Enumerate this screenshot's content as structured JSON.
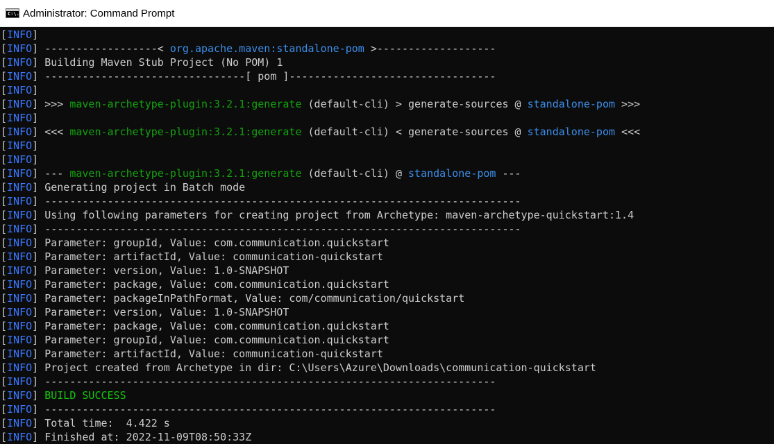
{
  "window": {
    "title": "Administrator: Command Prompt",
    "icon": "cmd-icon",
    "icon_text": "C:\\."
  },
  "colors": {
    "background": "#0c0c0c",
    "default_text": "#cccccc",
    "info_tag": "#3b78ff",
    "plugin_green": "#13a10e",
    "success_green": "#16c60c",
    "project_blue": "#3b8eea"
  },
  "console": {
    "lines": [
      [
        {
          "t": "[",
          "c": "white"
        },
        {
          "t": "INFO",
          "c": "info"
        },
        {
          "t": "]",
          "c": "white"
        }
      ],
      [
        {
          "t": "[",
          "c": "white"
        },
        {
          "t": "INFO",
          "c": "info"
        },
        {
          "t": "] ------------------< ",
          "c": "white"
        },
        {
          "t": "org.apache.maven:standalone-pom",
          "c": "blue"
        },
        {
          "t": " >-------------------",
          "c": "white"
        }
      ],
      [
        {
          "t": "[",
          "c": "white"
        },
        {
          "t": "INFO",
          "c": "info"
        },
        {
          "t": "] Building Maven Stub Project (No POM) 1",
          "c": "white"
        }
      ],
      [
        {
          "t": "[",
          "c": "white"
        },
        {
          "t": "INFO",
          "c": "info"
        },
        {
          "t": "] --------------------------------[ pom ]---------------------------------",
          "c": "white"
        }
      ],
      [
        {
          "t": "[",
          "c": "white"
        },
        {
          "t": "INFO",
          "c": "info"
        },
        {
          "t": "]",
          "c": "white"
        }
      ],
      [
        {
          "t": "[",
          "c": "white"
        },
        {
          "t": "INFO",
          "c": "info"
        },
        {
          "t": "] >>> ",
          "c": "white"
        },
        {
          "t": "maven-archetype-plugin:3.2.1:generate",
          "c": "green"
        },
        {
          "t": " (default-cli) > generate-sources @ ",
          "c": "white"
        },
        {
          "t": "standalone-pom",
          "c": "blue"
        },
        {
          "t": " >>>",
          "c": "white"
        }
      ],
      [
        {
          "t": "[",
          "c": "white"
        },
        {
          "t": "INFO",
          "c": "info"
        },
        {
          "t": "]",
          "c": "white"
        }
      ],
      [
        {
          "t": "[",
          "c": "white"
        },
        {
          "t": "INFO",
          "c": "info"
        },
        {
          "t": "] <<< ",
          "c": "white"
        },
        {
          "t": "maven-archetype-plugin:3.2.1:generate",
          "c": "green"
        },
        {
          "t": " (default-cli) < generate-sources @ ",
          "c": "white"
        },
        {
          "t": "standalone-pom",
          "c": "blue"
        },
        {
          "t": " <<<",
          "c": "white"
        }
      ],
      [
        {
          "t": "[",
          "c": "white"
        },
        {
          "t": "INFO",
          "c": "info"
        },
        {
          "t": "]",
          "c": "white"
        }
      ],
      [
        {
          "t": "[",
          "c": "white"
        },
        {
          "t": "INFO",
          "c": "info"
        },
        {
          "t": "]",
          "c": "white"
        }
      ],
      [
        {
          "t": "[",
          "c": "white"
        },
        {
          "t": "INFO",
          "c": "info"
        },
        {
          "t": "] --- ",
          "c": "white"
        },
        {
          "t": "maven-archetype-plugin:3.2.1:generate",
          "c": "green"
        },
        {
          "t": " (default-cli) @ ",
          "c": "white"
        },
        {
          "t": "standalone-pom",
          "c": "blue"
        },
        {
          "t": " ---",
          "c": "white"
        }
      ],
      [
        {
          "t": "[",
          "c": "white"
        },
        {
          "t": "INFO",
          "c": "info"
        },
        {
          "t": "] Generating project in Batch mode",
          "c": "white"
        }
      ],
      [
        {
          "t": "[",
          "c": "white"
        },
        {
          "t": "INFO",
          "c": "info"
        },
        {
          "t": "] ----------------------------------------------------------------------------",
          "c": "white"
        }
      ],
      [
        {
          "t": "[",
          "c": "white"
        },
        {
          "t": "INFO",
          "c": "info"
        },
        {
          "t": "] Using following parameters for creating project from Archetype: maven-archetype-quickstart:1.4",
          "c": "white"
        }
      ],
      [
        {
          "t": "[",
          "c": "white"
        },
        {
          "t": "INFO",
          "c": "info"
        },
        {
          "t": "] ----------------------------------------------------------------------------",
          "c": "white"
        }
      ],
      [
        {
          "t": "[",
          "c": "white"
        },
        {
          "t": "INFO",
          "c": "info"
        },
        {
          "t": "] Parameter: groupId, Value: com.communication.quickstart",
          "c": "white"
        }
      ],
      [
        {
          "t": "[",
          "c": "white"
        },
        {
          "t": "INFO",
          "c": "info"
        },
        {
          "t": "] Parameter: artifactId, Value: communication-quickstart",
          "c": "white"
        }
      ],
      [
        {
          "t": "[",
          "c": "white"
        },
        {
          "t": "INFO",
          "c": "info"
        },
        {
          "t": "] Parameter: version, Value: 1.0-SNAPSHOT",
          "c": "white"
        }
      ],
      [
        {
          "t": "[",
          "c": "white"
        },
        {
          "t": "INFO",
          "c": "info"
        },
        {
          "t": "] Parameter: package, Value: com.communication.quickstart",
          "c": "white"
        }
      ],
      [
        {
          "t": "[",
          "c": "white"
        },
        {
          "t": "INFO",
          "c": "info"
        },
        {
          "t": "] Parameter: packageInPathFormat, Value: com/communication/quickstart",
          "c": "white"
        }
      ],
      [
        {
          "t": "[",
          "c": "white"
        },
        {
          "t": "INFO",
          "c": "info"
        },
        {
          "t": "] Parameter: version, Value: 1.0-SNAPSHOT",
          "c": "white"
        }
      ],
      [
        {
          "t": "[",
          "c": "white"
        },
        {
          "t": "INFO",
          "c": "info"
        },
        {
          "t": "] Parameter: package, Value: com.communication.quickstart",
          "c": "white"
        }
      ],
      [
        {
          "t": "[",
          "c": "white"
        },
        {
          "t": "INFO",
          "c": "info"
        },
        {
          "t": "] Parameter: groupId, Value: com.communication.quickstart",
          "c": "white"
        }
      ],
      [
        {
          "t": "[",
          "c": "white"
        },
        {
          "t": "INFO",
          "c": "info"
        },
        {
          "t": "] Parameter: artifactId, Value: communication-quickstart",
          "c": "white"
        }
      ],
      [
        {
          "t": "[",
          "c": "white"
        },
        {
          "t": "INFO",
          "c": "info"
        },
        {
          "t": "] Project created from Archetype in dir: C:\\Users\\Azure\\Downloads\\communication-quickstart",
          "c": "white"
        }
      ],
      [
        {
          "t": "[",
          "c": "white"
        },
        {
          "t": "INFO",
          "c": "info"
        },
        {
          "t": "] ------------------------------------------------------------------------",
          "c": "white"
        }
      ],
      [
        {
          "t": "[",
          "c": "white"
        },
        {
          "t": "INFO",
          "c": "info"
        },
        {
          "t": "] ",
          "c": "white"
        },
        {
          "t": "BUILD SUCCESS",
          "c": "success"
        }
      ],
      [
        {
          "t": "[",
          "c": "white"
        },
        {
          "t": "INFO",
          "c": "info"
        },
        {
          "t": "] ------------------------------------------------------------------------",
          "c": "white"
        }
      ],
      [
        {
          "t": "[",
          "c": "white"
        },
        {
          "t": "INFO",
          "c": "info"
        },
        {
          "t": "] Total time:  4.422 s",
          "c": "white"
        }
      ],
      [
        {
          "t": "[",
          "c": "white"
        },
        {
          "t": "INFO",
          "c": "info"
        },
        {
          "t": "] Finished at: 2022-11-09T08:50:33Z",
          "c": "white"
        }
      ]
    ]
  }
}
